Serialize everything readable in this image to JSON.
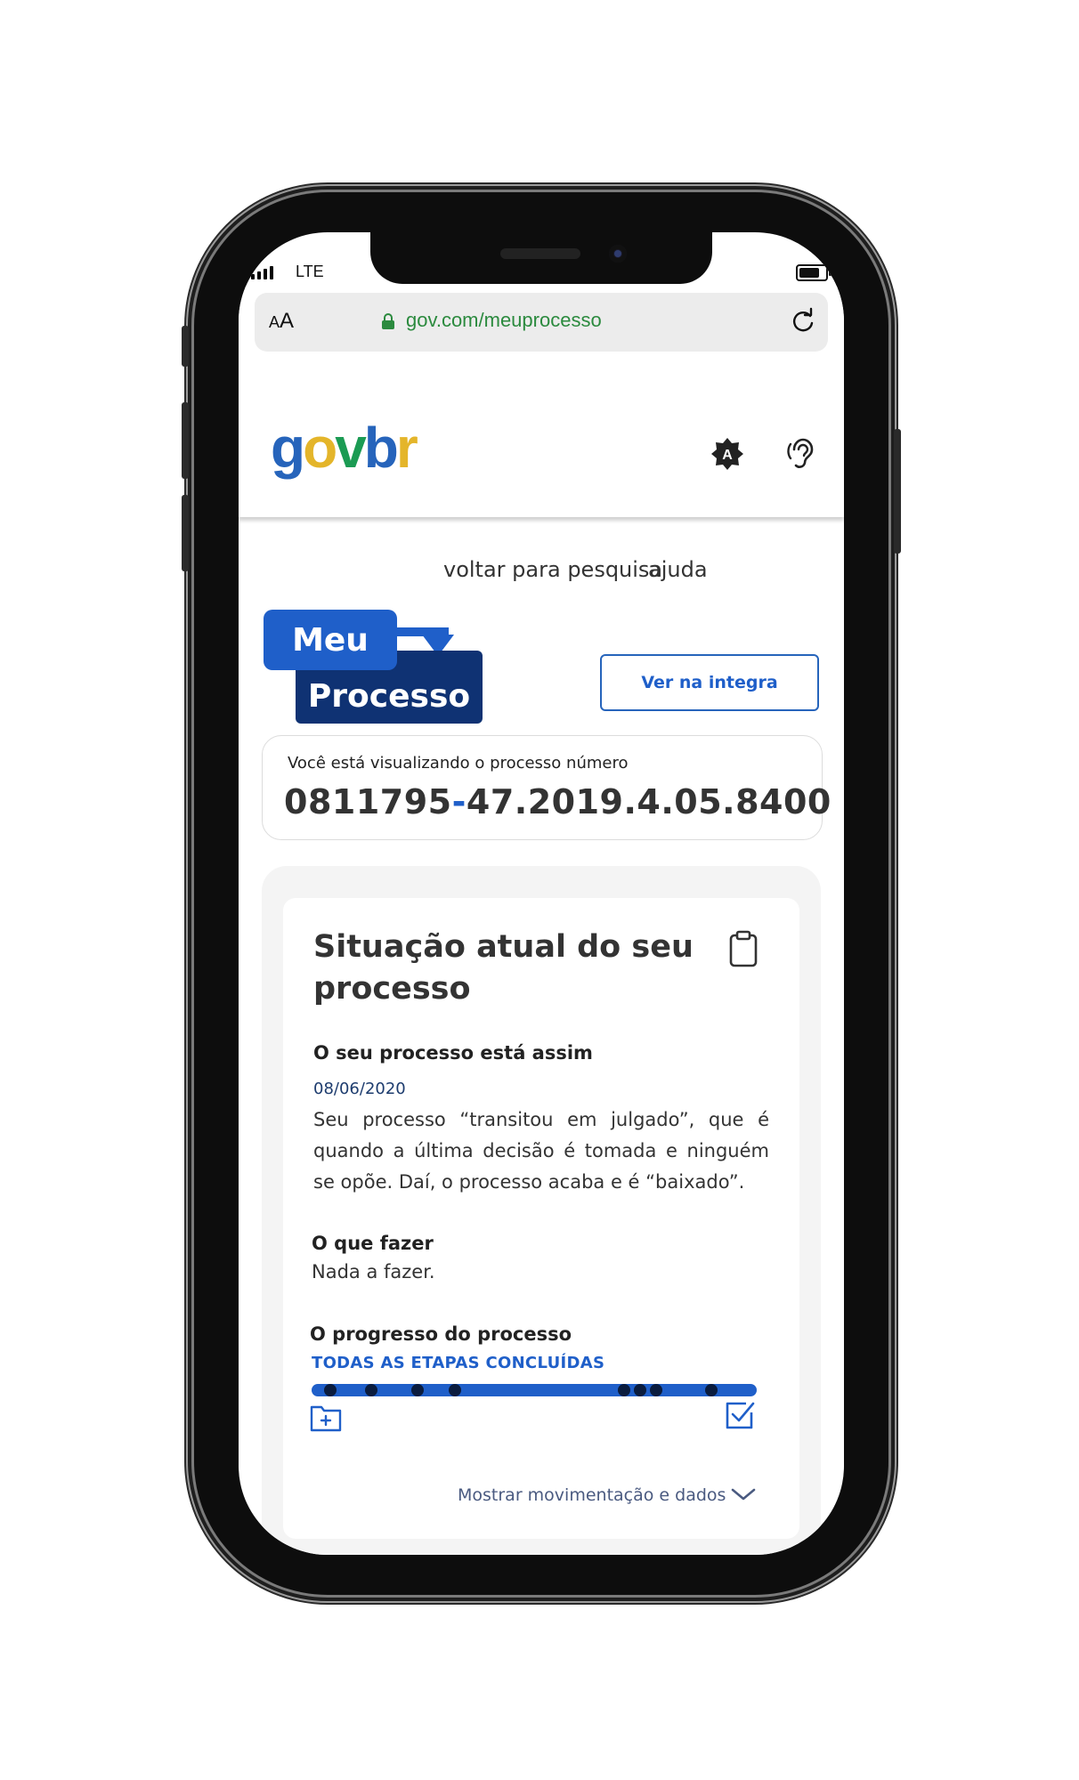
{
  "status_bar": {
    "carrier": "LTE"
  },
  "browser": {
    "text_size": {
      "small": "A",
      "large": "A"
    },
    "url": "gov.com/meuprocesso"
  },
  "header": {
    "logo": {
      "g": "g",
      "o": "o",
      "v": "v",
      "dot": ".",
      "b": "b",
      "r": "r"
    },
    "contrast_icon_letter": "A"
  },
  "nav": {
    "back_link": "voltar para pesquisa",
    "help_link": "ajuda"
  },
  "brand": {
    "line1": "Meu",
    "line2": "Processo"
  },
  "ver_button": "Ver na integra",
  "process": {
    "label": "Você está visualizando o processo número",
    "number_part1": "0811795",
    "number_sep": "-",
    "number_part2": "47.2019.4.05.8400"
  },
  "situation": {
    "title": "Situação atual do seu processo",
    "status_heading": "O seu processo está assim",
    "date": "08/06/2020",
    "description": "Seu processo “transitou em julgado”, que é quando a última decisão é tomada e ninguém se opõe.  Daí, o processo acaba e é “baixado”.",
    "todo_heading": "O que fazer",
    "todo_text": "Nada a fazer.",
    "progress_heading": "O progresso do processo",
    "progress_status": "TODAS AS ETAPAS CONCLUÍDAS",
    "progress_fraction": 1.0,
    "show_more": "Mostrar movimentação e dados"
  },
  "colors": {
    "brand_blue": "#1f5fc9",
    "dark_blue": "#0f3273",
    "url_green": "#2b8a3e",
    "logo_yellow": "#e4b52a",
    "logo_green": "#1b9b53"
  }
}
